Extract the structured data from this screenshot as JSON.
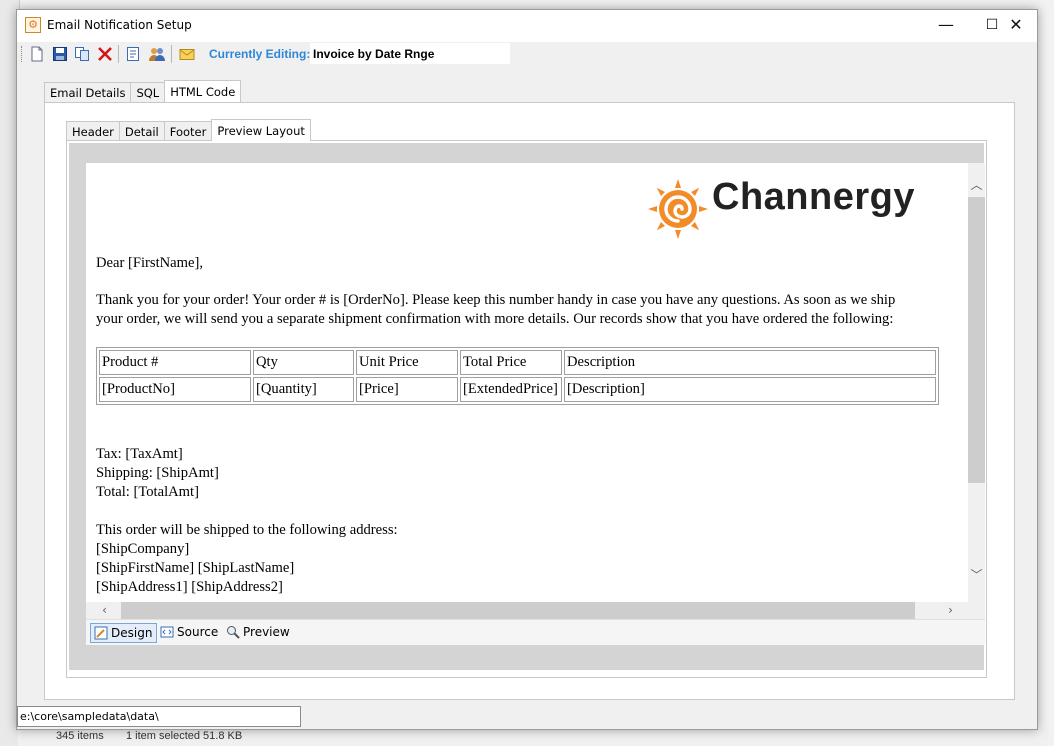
{
  "window": {
    "title": "Email Notification Setup",
    "minimize": "—",
    "maximize": "☐",
    "close": "✕"
  },
  "toolbar": {
    "editing_label": "Currently Editing:",
    "editing_value": "Invoice by Date Rnge",
    "icons": [
      "new-document-icon",
      "save-icon",
      "copy-icon",
      "delete-icon",
      "report-icon",
      "users-icon",
      "email-icon"
    ]
  },
  "outer_tabs": [
    "Email Details",
    "SQL",
    "HTML Code"
  ],
  "outer_active": "HTML Code",
  "inner_tabs": [
    "Header",
    "Detail",
    "Footer",
    "Preview Layout"
  ],
  "inner_active": "Preview Layout",
  "document": {
    "logo_text": "Channergy",
    "greeting": "Dear [FirstName],",
    "intro_line1": "Thank you for your order! Your order # is [OrderNo]. Please keep this number handy in case you have any questions. As soon as we ship",
    "intro_line2": "your order, we will send you a separate shipment confirmation with more details. Our records show that you have ordered the following:",
    "table": {
      "headers": [
        "Product #",
        "Qty",
        "Unit Price",
        "Total Price",
        "Description"
      ],
      "rows": [
        [
          "[ProductNo]",
          "[Quantity]",
          "[Price]",
          "[ExtendedPrice]",
          "[Description]"
        ]
      ]
    },
    "tax": "Tax: [TaxAmt]",
    "shipping": "Shipping: [ShipAmt]",
    "total": "Total: [TotalAmt]",
    "ship_intro": "This order will be shipped to the following address:",
    "ship_company": "[ShipCompany]",
    "ship_name": "[ShipFirstName] [ShipLastName]",
    "ship_address": "[ShipAddress1] [ShipAddress2]"
  },
  "modes": [
    "Design",
    "Source",
    "Preview"
  ],
  "active_mode": "Design",
  "path": "e:\\core\\sampledata\\data\\",
  "background_status": {
    "items": "345 items",
    "selected": "1 item selected  51.8 KB"
  },
  "colors": {
    "accent_label": "#2f86d4",
    "logo_orange": "#f28c28"
  }
}
